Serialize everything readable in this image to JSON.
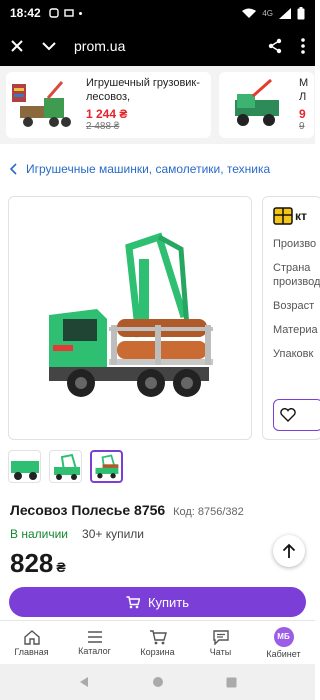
{
  "status_bar": {
    "time": "18:42",
    "network": "4G"
  },
  "browser": {
    "url": "prom.ua"
  },
  "ads": [
    {
      "title": "Игрушечный грузовик-лесовоз,",
      "price": "1 244 ₴",
      "old_price": "2 488 ₴"
    },
    {
      "title": "М Л",
      "price": "9",
      "old_price": "9"
    }
  ],
  "breadcrumb": {
    "label": "Игрушечные машинки, самолетики, техника"
  },
  "seller": {
    "logo_text": "кт",
    "rows": [
      "Произво",
      "Страна производ",
      "Возраст",
      "Материа",
      "Упаковк"
    ]
  },
  "product": {
    "title": "Лесовоз Полесье 8756",
    "code": "Код: 8756/382",
    "availability": "В наличии",
    "bought": "30+ купили",
    "price": "828",
    "currency": "₴",
    "buy_label": "Купить"
  },
  "nav": [
    {
      "label": "Главная",
      "icon": "home-icon"
    },
    {
      "label": "Каталог",
      "icon": "menu-icon"
    },
    {
      "label": "Корзина",
      "icon": "cart-icon"
    },
    {
      "label": "Чаты",
      "icon": "chat-icon"
    },
    {
      "label": "Кабинет",
      "icon": "avatar",
      "avatar_text": "МБ"
    }
  ],
  "colors": {
    "accent": "#7b3fd8",
    "in_stock": "#16862f",
    "sale_price": "#e5242b",
    "link": "#2a6ac8",
    "truck_green": "#2fbf72"
  }
}
